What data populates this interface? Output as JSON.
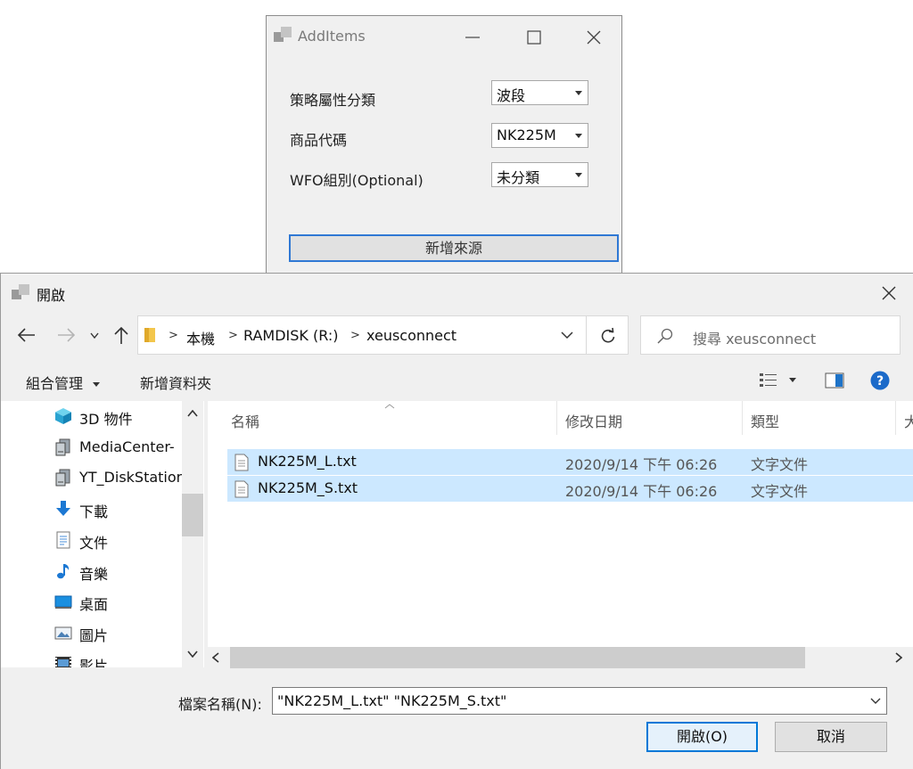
{
  "add_items": {
    "title": "AddItems",
    "fields": [
      {
        "label": "策略屬性分類",
        "value": "波段"
      },
      {
        "label": "商品代碼",
        "value": "NK225M"
      },
      {
        "label": "WFO組別(Optional)",
        "value": "未分類"
      }
    ],
    "add_source_label": "新增來源"
  },
  "open_dialog": {
    "title": "開啟",
    "breadcrumb": [
      "本機",
      "RAMDISK (R:)",
      "xeusconnect"
    ],
    "search_placeholder": "搜尋 xeusconnect",
    "toolbar": {
      "organize_label": "組合管理",
      "new_folder_label": "新增資料夾"
    },
    "nav_items": [
      {
        "label": "3D 物件",
        "icon": "3d-objects-icon"
      },
      {
        "label": "MediaCenter-",
        "icon": "network-drive-icon"
      },
      {
        "label": "YT_DiskStation",
        "icon": "network-drive-icon"
      },
      {
        "label": "下載",
        "icon": "download-icon"
      },
      {
        "label": "文件",
        "icon": "documents-icon"
      },
      {
        "label": "音樂",
        "icon": "music-icon"
      },
      {
        "label": "桌面",
        "icon": "desktop-icon"
      },
      {
        "label": "圖片",
        "icon": "pictures-icon"
      },
      {
        "label": "影片",
        "icon": "videos-icon"
      }
    ],
    "columns": {
      "name": "名稱",
      "date": "修改日期",
      "type": "類型",
      "size": "大"
    },
    "files": [
      {
        "name": "NK225M_L.txt",
        "date": "2020/9/14 下午 06:26",
        "type": "文字文件"
      },
      {
        "name": "NK225M_S.txt",
        "date": "2020/9/14 下午 06:26",
        "type": "文字文件"
      }
    ],
    "filename_label": "檔案名稱(N):",
    "filename_value": "\"NK225M_L.txt\" \"NK225M_S.txt\"",
    "open_label": "開啟(O)",
    "cancel_label": "取消"
  },
  "colors": {
    "selection": "#cce8ff",
    "accent": "#0078d7"
  }
}
